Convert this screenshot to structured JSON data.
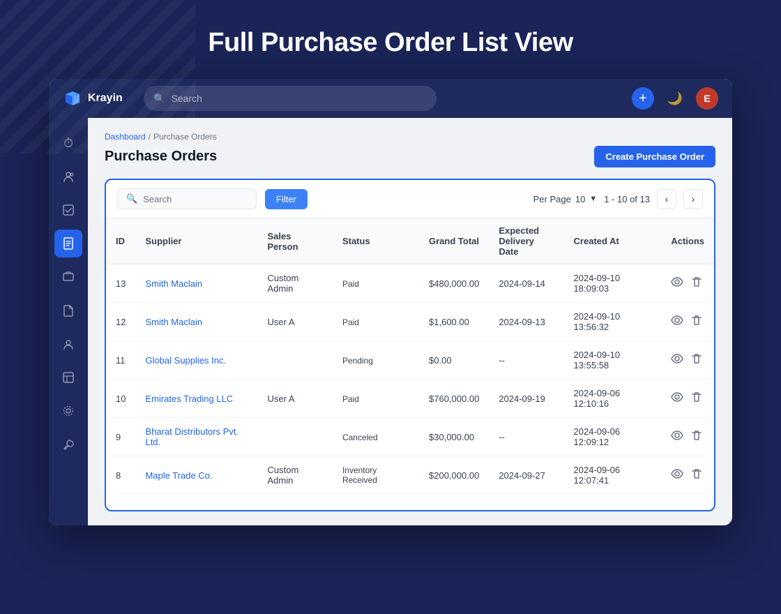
{
  "page": {
    "bg_title": "Full Purchase Order List View"
  },
  "nav": {
    "logo_text": "Krayin",
    "search_placeholder": "Search",
    "add_button_label": "+",
    "user_initials": "E"
  },
  "sidebar": {
    "items": [
      {
        "icon": "⏱",
        "name": "dashboard",
        "active": false
      },
      {
        "icon": "✿",
        "name": "contacts",
        "active": false
      },
      {
        "icon": "📋",
        "name": "tasks",
        "active": false
      },
      {
        "icon": "📦",
        "name": "purchase-orders",
        "active": true
      },
      {
        "icon": "📺",
        "name": "products",
        "active": false
      },
      {
        "icon": "📄",
        "name": "documents",
        "active": false
      },
      {
        "icon": "👤",
        "name": "users",
        "active": false
      },
      {
        "icon": "⊟",
        "name": "inventory",
        "active": false
      },
      {
        "icon": "◎",
        "name": "settings",
        "active": false
      },
      {
        "icon": "🔧",
        "name": "tools",
        "active": false
      }
    ]
  },
  "breadcrumb": {
    "home": "Dashboard",
    "separator": "/",
    "current": "Purchase Orders"
  },
  "header": {
    "title": "Purchase Orders",
    "create_button": "Create Purchase Order"
  },
  "toolbar": {
    "search_placeholder": "Search",
    "filter_button": "Filter",
    "per_page_label": "Per Page",
    "per_page_value": "10",
    "pagination_text": "1 - 10 of 13"
  },
  "table": {
    "columns": [
      "ID",
      "Supplier",
      "Sales Person",
      "Status",
      "Grand Total",
      "Expected Delivery Date",
      "Created At",
      "Actions"
    ],
    "rows": [
      {
        "id": "13",
        "supplier": "Smith Maclain",
        "sales_person": "Custom Admin",
        "status": "Paid",
        "grand_total": "$480,000.00",
        "expected_delivery": "2024-09-14",
        "created_at": "2024-09-10 18:09:03"
      },
      {
        "id": "12",
        "supplier": "Smith Maclain",
        "sales_person": "User A",
        "status": "Paid",
        "grand_total": "$1,600.00",
        "expected_delivery": "2024-09-13",
        "created_at": "2024-09-10 13:56:32"
      },
      {
        "id": "11",
        "supplier": "Global Supplies Inc.",
        "sales_person": "",
        "status": "Pending",
        "grand_total": "$0.00",
        "expected_delivery": "--",
        "created_at": "2024-09-10 13:55:58"
      },
      {
        "id": "10",
        "supplier": "Emirates Trading LLC",
        "sales_person": "User A",
        "status": "Paid",
        "grand_total": "$760,000.00",
        "expected_delivery": "2024-09-19",
        "created_at": "2024-09-06 12:10:16"
      },
      {
        "id": "9",
        "supplier": "Bharat Distributors Pvt. Ltd.",
        "sales_person": "",
        "status": "Canceled",
        "grand_total": "$30,000.00",
        "expected_delivery": "--",
        "created_at": "2024-09-06 12:09:12"
      },
      {
        "id": "8",
        "supplier": "Maple Trade Co.",
        "sales_person": "Custom Admin",
        "status": "Inventory Received",
        "grand_total": "$200,000.00",
        "expected_delivery": "2024-09-27",
        "created_at": "2024-09-06 12:07:41"
      }
    ]
  }
}
